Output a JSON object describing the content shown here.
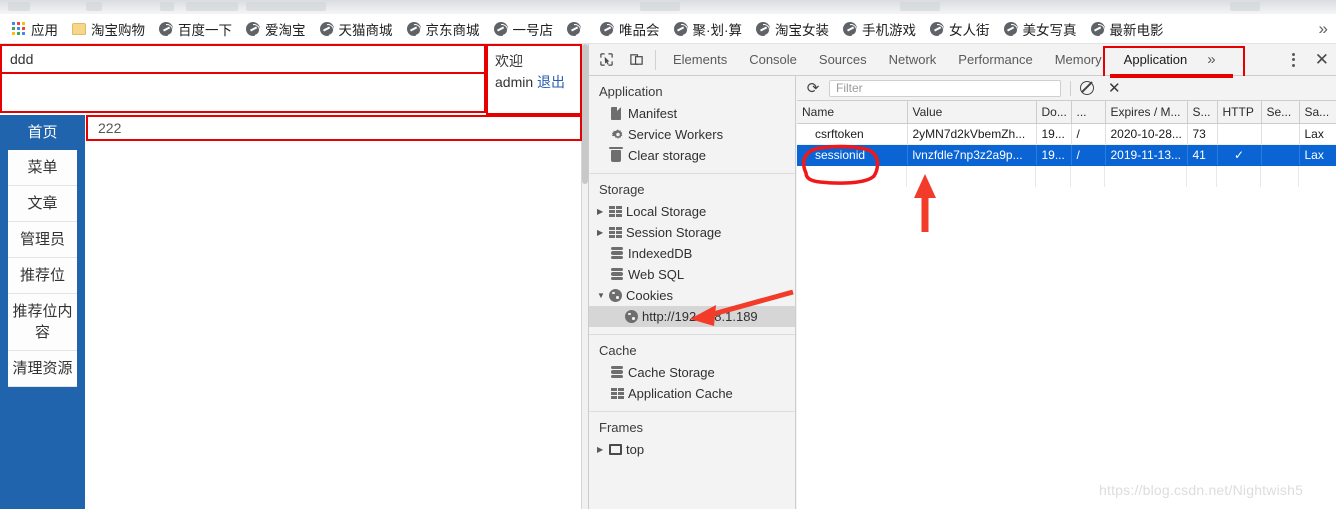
{
  "browser": {
    "bookmarks": [
      {
        "label": "应用",
        "icon": "apps-grid-icon"
      },
      {
        "label": "淘宝购物",
        "icon": "folder-icon"
      },
      {
        "label": "百度一下",
        "icon": "globe-icon"
      },
      {
        "label": "爱淘宝",
        "icon": "globe-icon"
      },
      {
        "label": "天猫商城",
        "icon": "globe-icon"
      },
      {
        "label": "京东商城",
        "icon": "globe-icon"
      },
      {
        "label": "一号店",
        "icon": "globe-icon"
      },
      {
        "label": "",
        "icon": "globe-icon"
      },
      {
        "label": "唯品会",
        "icon": "globe-icon"
      },
      {
        "label": "聚·划·算",
        "icon": "globe-icon"
      },
      {
        "label": "淘宝女装",
        "icon": "globe-icon"
      },
      {
        "label": "手机游戏",
        "icon": "globe-icon"
      },
      {
        "label": "女人街",
        "icon": "globe-icon"
      },
      {
        "label": "美女写真",
        "icon": "globe-icon"
      },
      {
        "label": "最新电影",
        "icon": "globe-icon"
      }
    ],
    "overflow_label": "»"
  },
  "page": {
    "top_input_value": "ddd",
    "welcome": {
      "greeting": "欢迎",
      "user": "admin",
      "logout_label": "退出"
    },
    "content_value": "222",
    "menu": [
      {
        "label": "首页",
        "active": true
      },
      {
        "label": "菜单",
        "active": false
      },
      {
        "label": "文章",
        "active": false
      },
      {
        "label": "管理员",
        "active": false
      },
      {
        "label": "推荐位",
        "active": false
      },
      {
        "label": "推荐位内容",
        "active": false
      },
      {
        "label": "清理资源",
        "active": false
      }
    ]
  },
  "devtools": {
    "tabs": [
      {
        "label": "Elements",
        "selected": false
      },
      {
        "label": "Console",
        "selected": false
      },
      {
        "label": "Sources",
        "selected": false
      },
      {
        "label": "Network",
        "selected": false
      },
      {
        "label": "Performance",
        "selected": false
      },
      {
        "label": "Memory",
        "selected": false
      },
      {
        "label": "Application",
        "selected": true
      }
    ],
    "more_tabs_label": "»",
    "close_label": "✕",
    "application_panel": {
      "groups": [
        {
          "title": "Application",
          "items": [
            {
              "label": "Manifest",
              "icon": "document-icon",
              "twisty": "",
              "selected": false
            },
            {
              "label": "Service Workers",
              "icon": "gear-icon",
              "twisty": "",
              "selected": false
            },
            {
              "label": "Clear storage",
              "icon": "trash-icon",
              "twisty": "",
              "selected": false
            }
          ]
        },
        {
          "title": "Storage",
          "items": [
            {
              "label": "Local Storage",
              "icon": "table-icon",
              "twisty": "▶",
              "selected": false
            },
            {
              "label": "Session Storage",
              "icon": "table-icon",
              "twisty": "▶",
              "selected": false
            },
            {
              "label": "IndexedDB",
              "icon": "database-icon",
              "twisty": "",
              "selected": false
            },
            {
              "label": "Web SQL",
              "icon": "database-icon",
              "twisty": "",
              "selected": false
            },
            {
              "label": "Cookies",
              "icon": "cookie-icon",
              "twisty": "▼",
              "selected": false
            },
            {
              "label": "http://192.168.1.189",
              "icon": "cookie-icon",
              "twisty": "",
              "selected": true
            }
          ]
        },
        {
          "title": "Cache",
          "items": [
            {
              "label": "Cache Storage",
              "icon": "database-icon",
              "twisty": "",
              "selected": false
            },
            {
              "label": "Application Cache",
              "icon": "table-icon",
              "twisty": "",
              "selected": false
            }
          ]
        },
        {
          "title": "Frames",
          "items": [
            {
              "label": "top",
              "icon": "frame-icon",
              "twisty": "▶",
              "selected": false
            }
          ]
        }
      ]
    },
    "cookie_table": {
      "toolbar": {
        "refresh_label": "⟳",
        "filter_placeholder": "Filter",
        "filter_value": "",
        "block_label": "block-third-party-cookies-icon",
        "clear_label": "✕"
      },
      "columns": [
        "Name",
        "Value",
        "Do...",
        "...",
        "Expires / M...",
        "S...",
        "HTTP",
        "Se...",
        "Sa..."
      ],
      "rows": [
        {
          "selected": false,
          "cells": [
            "csrftoken",
            "2yMN7d2kVbemZh...",
            "19...",
            "/",
            "2020-10-28...",
            "73",
            "",
            "",
            "Lax"
          ]
        },
        {
          "selected": true,
          "cells": [
            "sessionid",
            "lvnzfdle7np3z2a9p...",
            "19...",
            "/",
            "2019-11-13...",
            "41",
            "✓",
            "",
            "Lax"
          ]
        }
      ]
    }
  },
  "watermark": "https://blog.csdn.net/Nightwish5",
  "colors": {
    "annotation_red": "#e60000",
    "selection_blue": "#0a64d4",
    "brand_blue": "#1f64ad",
    "tab_underline": "#1a73e8"
  }
}
